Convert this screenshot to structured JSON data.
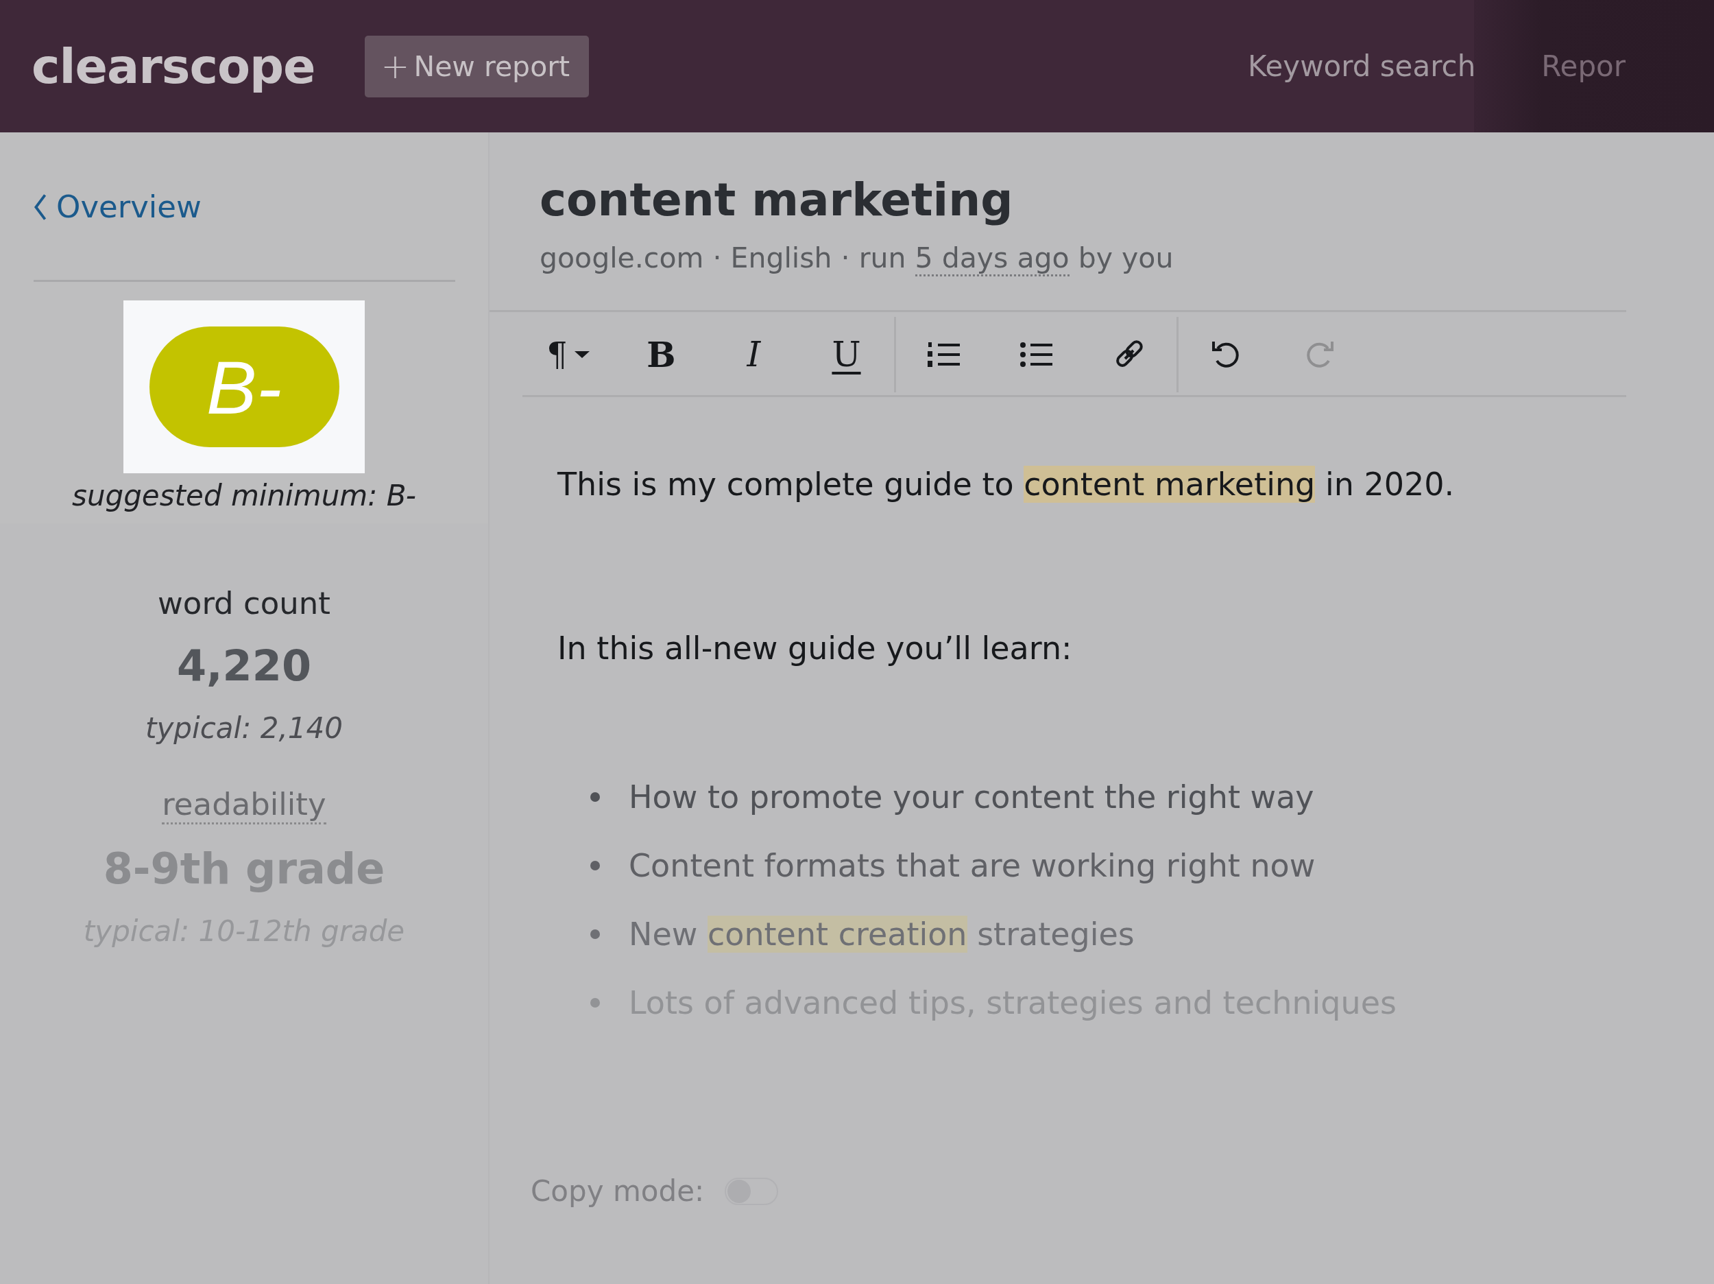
{
  "header": {
    "logo": "clearscope",
    "new_button": {
      "icon": "+",
      "label": "New report"
    },
    "nav": [
      {
        "label": "Keyword search"
      },
      {
        "label": "Repor"
      }
    ]
  },
  "sidebar": {
    "back_link": "Overview",
    "grade": {
      "value": "B-",
      "caption": "suggested minimum: B-"
    },
    "stats": [
      {
        "label": "word count",
        "value": "4,220",
        "typical": "typical: 2,140",
        "dotted": false
      },
      {
        "label": "readability",
        "value": "8-9th grade",
        "typical": "typical: 10-12th grade",
        "dotted": true
      }
    ]
  },
  "report": {
    "title": "content marketing",
    "meta": "google.com · English · run",
    "run_time": "5 days ago",
    "run_suffix": "by you"
  },
  "toolbar": [
    {
      "kind": "paragraph",
      "label": "¶",
      "disabled": false
    },
    {
      "kind": "bold",
      "label": "B",
      "disabled": false
    },
    {
      "kind": "italic",
      "label": "I",
      "disabled": false
    },
    {
      "kind": "underline",
      "label": "U",
      "disabled": false
    },
    {
      "kind": "separator"
    },
    {
      "kind": "numbered-list",
      "disabled": false
    },
    {
      "kind": "bullet-list",
      "disabled": false
    },
    {
      "kind": "link",
      "disabled": false
    },
    {
      "kind": "separator"
    },
    {
      "kind": "undo",
      "disabled": false
    },
    {
      "kind": "redo",
      "disabled": true
    }
  ],
  "document": [
    {
      "kind": "paragraph",
      "segments": [
        {
          "text": "This is my complete guide to ",
          "highlighted": false
        },
        {
          "text": "content marketing",
          "highlighted": true
        },
        {
          "text": " in 2020.",
          "highlighted": false
        }
      ]
    },
    {
      "kind": "paragraph",
      "segments": [
        {
          "text": "In this all-new guide you’ll learn:",
          "highlighted": false
        }
      ]
    },
    {
      "kind": "bullets",
      "items": [
        [
          {
            "text": "How to promote your content the right way",
            "highlighted": false
          }
        ],
        [
          {
            "text": "Content formats that are working right now",
            "highlighted": false
          }
        ],
        [
          {
            "text": "New ",
            "highlighted": false
          },
          {
            "text": "content creation",
            "highlighted": true
          },
          {
            "text": " strategies",
            "highlighted": false
          }
        ],
        [
          {
            "text": "Lots of advanced tips, strategies and techniques",
            "highlighted": false
          }
        ]
      ]
    }
  ],
  "copy_mode": {
    "label": "Copy mode:",
    "on": false
  }
}
